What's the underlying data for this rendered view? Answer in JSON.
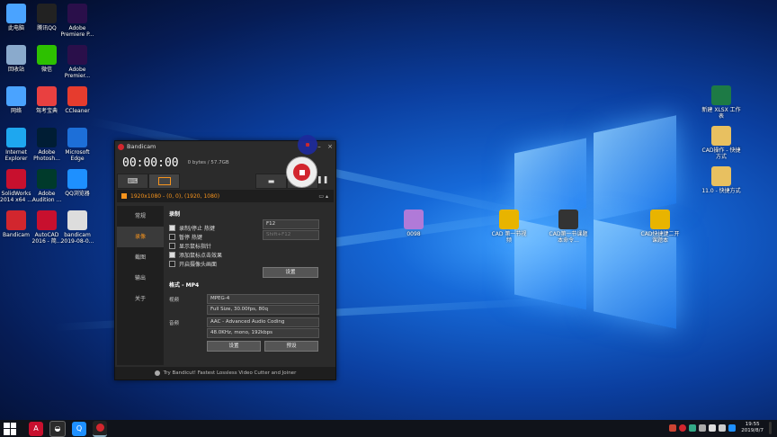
{
  "desktop": {
    "icons_left": [
      {
        "label": "此电脑",
        "icon": "computer-icon",
        "color": "#4aa3ff"
      },
      {
        "label": "腾讯QQ",
        "icon": "qq-icon",
        "color": "#222222"
      },
      {
        "label": "Adobe Premiere P...",
        "icon": "premiere-icon",
        "color": "#2a0f4a"
      },
      {
        "label": "回收站",
        "icon": "recycle-bin-icon",
        "color": "#8aaacc"
      },
      {
        "label": "微信",
        "icon": "wechat-icon",
        "color": "#2dc100"
      },
      {
        "label": "Adobe Premier...",
        "icon": "premiere-shortcut-icon",
        "color": "#2a0f4a"
      },
      {
        "label": "网络",
        "icon": "network-icon",
        "color": "#4aa3ff"
      },
      {
        "label": "驾考宝典",
        "icon": "car-icon",
        "color": "#e94040"
      },
      {
        "label": "CCleaner",
        "icon": "ccleaner-icon",
        "color": "#e63c2e"
      },
      {
        "label": "Internet Explorer",
        "icon": "ie-icon",
        "color": "#1ea7ef"
      },
      {
        "label": "Adobe Photosh...",
        "icon": "photoshop-icon",
        "color": "#001d34"
      },
      {
        "label": "Microsoft Edge",
        "icon": "edge-icon",
        "color": "#1d6fd8"
      },
      {
        "label": "SolidWorks 2014 x64 ...",
        "icon": "solidworks-icon",
        "color": "#c8102e"
      },
      {
        "label": "Adobe Audition ...",
        "icon": "audition-icon",
        "color": "#003a2b"
      },
      {
        "label": "QQ浏览器",
        "icon": "qq-browser-icon",
        "color": "#1e90ff"
      },
      {
        "label": "Bandicam",
        "icon": "bandicam-icon",
        "color": "#d2262e"
      },
      {
        "label": "AutoCAD 2016 - 简...",
        "icon": "autocad-icon",
        "color": "#c8102e"
      },
      {
        "label": "bandicam 2019-08-0...",
        "icon": "mp4-file-icon",
        "color": "#dddddd"
      }
    ],
    "icons_middle": [
      {
        "label": "0098",
        "icon": "image-file-icon",
        "color": "#b07ad8"
      },
      {
        "label": "CAD 第一节视频",
        "icon": "dwg-file-icon",
        "color": "#e8b400"
      },
      {
        "label": "CAD第一节课题本命令...",
        "icon": "dwg-file-icon",
        "color": "#333333"
      },
      {
        "label": "CAD快捷键二开课题本",
        "icon": "dwg-file-icon",
        "color": "#e8b400"
      }
    ],
    "icons_right": [
      {
        "label": "新建 XLSX 工作表",
        "icon": "excel-icon",
        "color": "#1d7a45"
      },
      {
        "label": "CAD操作 - 快捷方式",
        "icon": "shortcut-icon",
        "color": "#e8c060"
      },
      {
        "label": "11.0 - 快捷方式",
        "icon": "folder-shortcut-icon",
        "color": "#e8c060"
      }
    ]
  },
  "bandicam": {
    "title": "Bandicam",
    "help": "?",
    "minimize": "–",
    "close": "×",
    "timer": "00:00:00",
    "size": "0 bytes / 57.7GB",
    "mode_text": "1920x1080 - (0, 0), (1920, 1080)",
    "sidebar": [
      "常规",
      "录像",
      "截图",
      "输出",
      "关于"
    ],
    "record_section": "录制",
    "checkboxes": [
      {
        "label": "录制/停止 热键",
        "checked": true
      },
      {
        "label": "暂停 热键",
        "checked": false
      },
      {
        "label": "显示鼠标指针",
        "checked": false
      },
      {
        "label": "添加鼠标点击效果",
        "checked": true
      },
      {
        "label": "开启摄像头画面",
        "checked": false
      }
    ],
    "hotkey1": "F12",
    "hotkey2": "Shift+F12",
    "settings_btn": "设置",
    "format_title": "格式 - MP4",
    "video_label": "视频",
    "video_codec": "MPEG-4",
    "video_detail": "Full Size, 30.00fps, 80q",
    "audio_label": "音频",
    "audio_codec": "AAC - Advanced Audio Coding",
    "audio_detail": "48.0KHz, mono, 192kbps",
    "settings_btn2": "设置",
    "preset_btn": "预设",
    "footer": "Try Bandicut! Fastest Lossless Video Cutter and Joiner"
  },
  "taskbar": {
    "clock_time": "19:55",
    "clock_date": "2019/8/7"
  }
}
